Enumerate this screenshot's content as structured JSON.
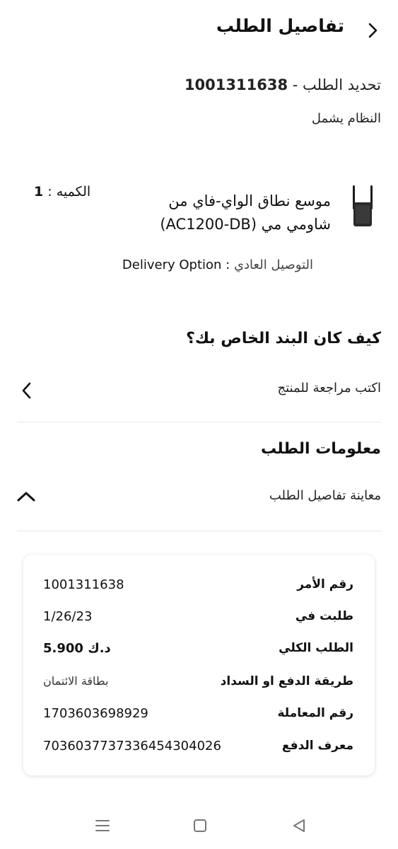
{
  "header": {
    "title": "تفاصيل الطلب"
  },
  "order": {
    "id_prefix": "تحديد الطلب - ",
    "id_number": "1001311638",
    "system_text": "النظام يشمل"
  },
  "product": {
    "title": "موسع نطاق الواي-فاي من شاومي مي (AC1200-DB)",
    "qty_label": "الكميه :",
    "qty_value": "1",
    "delivery_label": "Delivery Option : ",
    "delivery_value": "التوصيل العادي"
  },
  "review": {
    "heading": "كيف كان البند الخاص بك؟",
    "write_label": "اكتب مراجعة للمنتج"
  },
  "info": {
    "heading": "معلومات الطلب",
    "preview_label": "معاينة تفاصيل الطلب",
    "rows": [
      {
        "label": "رقم الأمر",
        "value": "1001311638"
      },
      {
        "label": "طلبت في",
        "value": "1/26/23"
      },
      {
        "label": "الطلب الكلي",
        "value": "د.ك 5.900"
      },
      {
        "label": "طريقة الدفع او السداد",
        "value": "بطاقة الائتمان"
      },
      {
        "label": "رقم المعاملة",
        "value": "1703603698929"
      },
      {
        "label": "معرف الدفع",
        "value": "7036037737336454304026"
      }
    ]
  },
  "icons": {
    "back": "chevron-right-icon",
    "review": "chevron-left-icon",
    "collapse": "chevron-up-icon",
    "nav_menu": "menu-icon",
    "nav_home": "square-icon",
    "nav_back": "triangle-back-icon"
  }
}
